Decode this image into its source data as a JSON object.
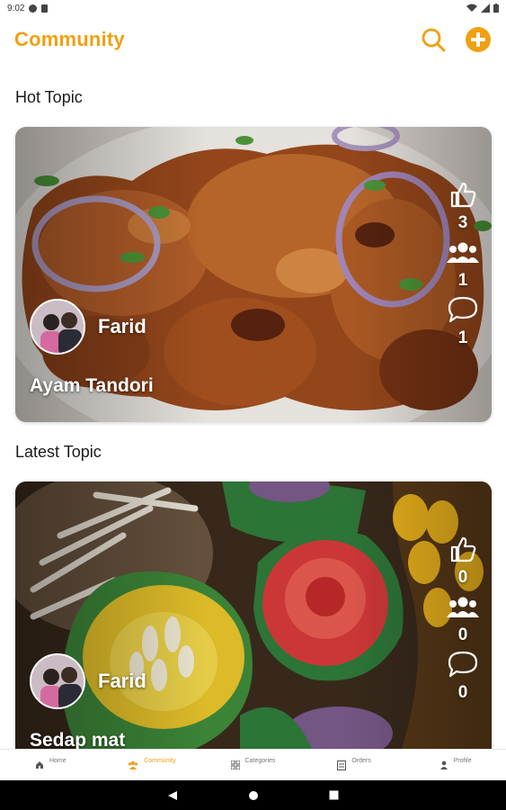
{
  "status_bar": {
    "time": "9:02"
  },
  "header": {
    "title": "Community",
    "search_icon": "search-icon",
    "add_icon": "plus-circle-icon"
  },
  "sections": {
    "hot": "Hot Topic",
    "latest": "Latest Topic"
  },
  "hot_post": {
    "author": "Farid",
    "title": "Ayam Tandori",
    "likes": "3",
    "members": "1",
    "comments": "1"
  },
  "latest_post": {
    "author": "Farid",
    "title": "Sedap mat",
    "likes": "0",
    "members": "0",
    "comments": "0"
  },
  "bottom_nav": [
    {
      "label": "Home",
      "icon": "home-icon",
      "active": false
    },
    {
      "label": "Community",
      "icon": "community-icon",
      "active": true
    },
    {
      "label": "Categories",
      "icon": "grid-icon",
      "active": false
    },
    {
      "label": "Orders",
      "icon": "orders-icon",
      "active": false
    },
    {
      "label": "Profile",
      "icon": "person-icon",
      "active": false
    }
  ],
  "colors": {
    "accent": "#f0a012",
    "text": "#1a1a1a",
    "inactive": "#777777"
  }
}
